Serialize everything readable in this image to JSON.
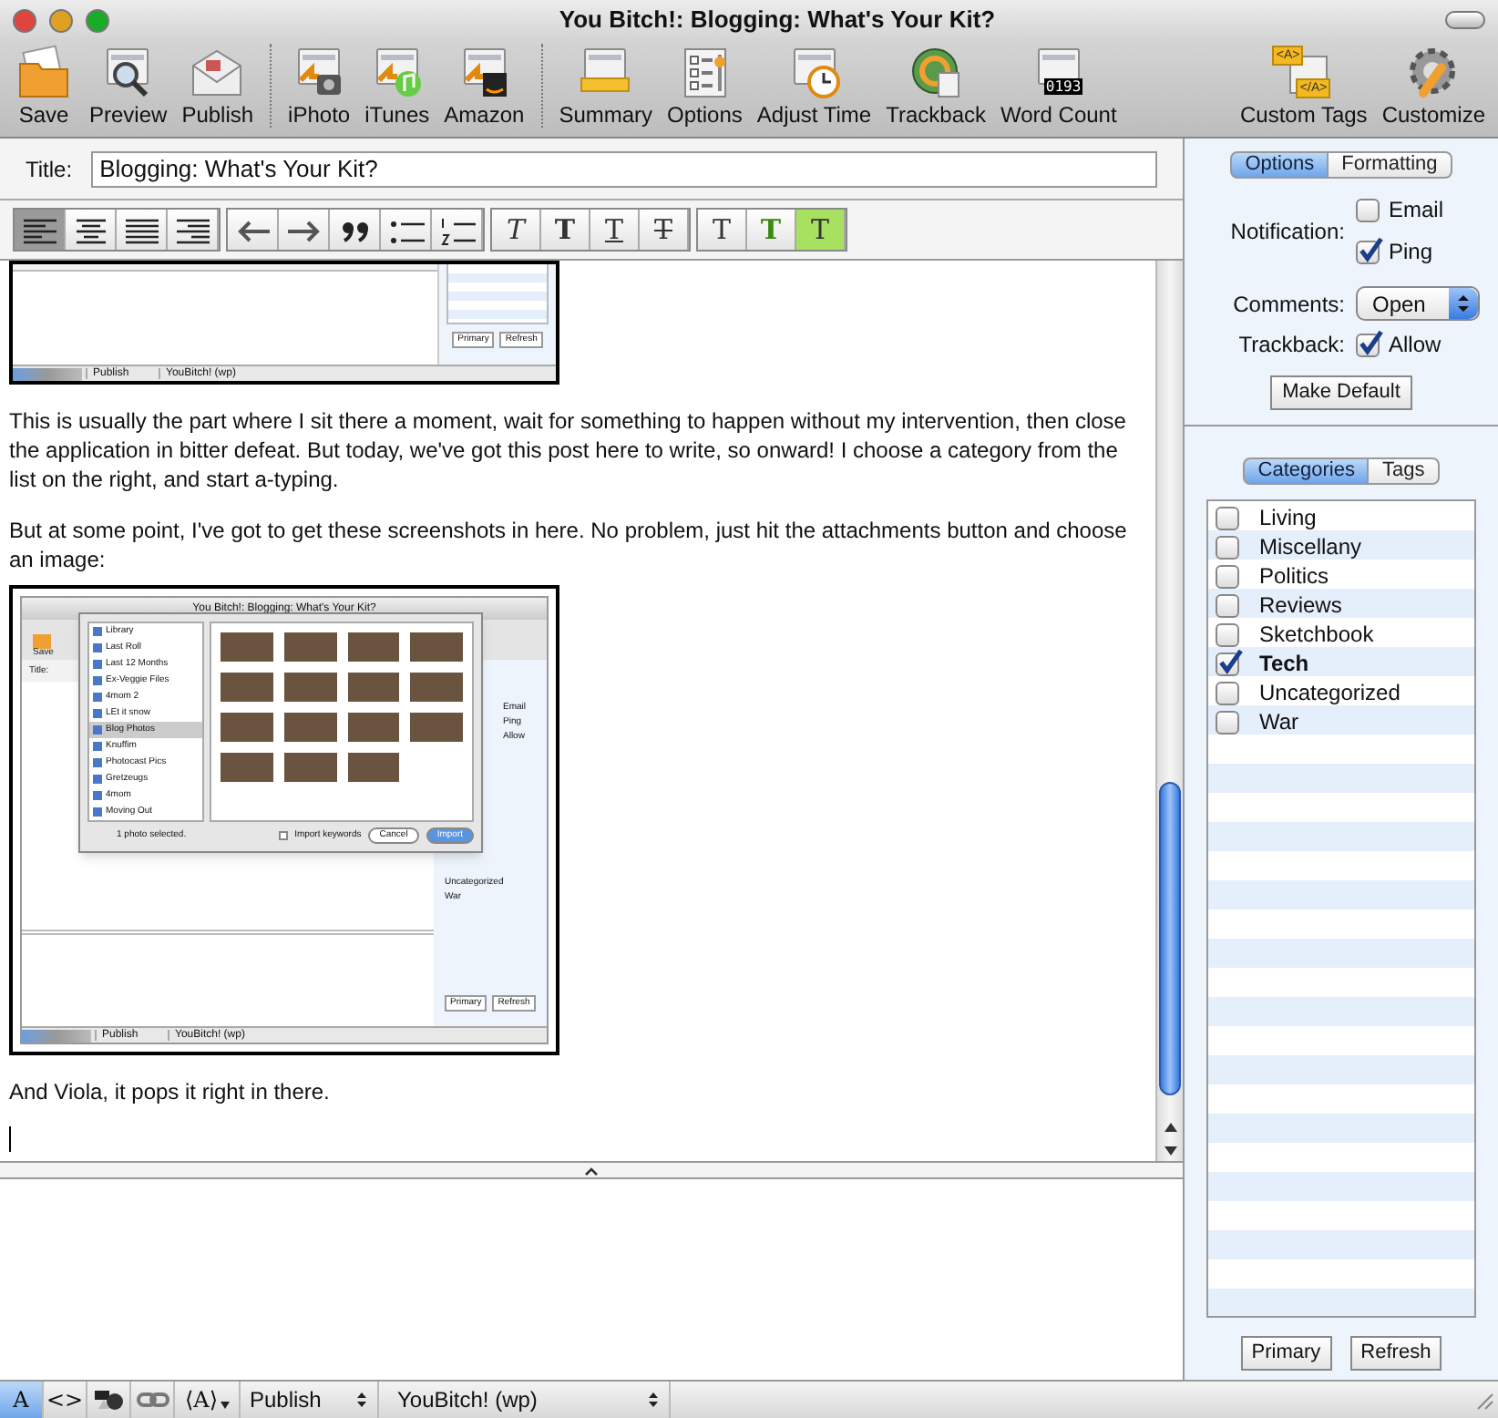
{
  "window": {
    "title": "You Bitch!: Blogging: What's Your Kit?"
  },
  "toolbar": {
    "groups": [
      {
        "items": [
          {
            "label": "Save"
          },
          {
            "label": "Preview"
          },
          {
            "label": "Publish"
          }
        ]
      },
      {
        "items": [
          {
            "label": "iPhoto"
          },
          {
            "label": "iTunes"
          },
          {
            "label": "Amazon"
          }
        ]
      },
      {
        "items": [
          {
            "label": "Summary"
          },
          {
            "label": "Options"
          },
          {
            "label": "Adjust Time"
          },
          {
            "label": "Trackback"
          },
          {
            "label": "Word Count",
            "icon_texts": [
              "0193"
            ]
          }
        ]
      },
      {
        "items": [
          {
            "label": "Custom Tags",
            "icon_texts": [
              "<A>",
              "</A>"
            ]
          },
          {
            "label": "Customize"
          }
        ]
      }
    ]
  },
  "title_field": {
    "label": "Title:",
    "value": "Blogging: What's Your Kit?"
  },
  "format_toolbar": {
    "alignment": [
      {
        "selected": true
      },
      {
        "selected": false
      },
      {
        "selected": false
      },
      {
        "selected": false
      }
    ],
    "style_groups": [
      {
        "items": [
          {
            "text": "T",
            "kind": "italic"
          },
          {
            "text": "T",
            "kind": "bold"
          },
          {
            "text": "T",
            "kind": "underline"
          },
          {
            "text": "T",
            "kind": "strike"
          }
        ]
      },
      {
        "items": [
          {
            "text": "T",
            "kind": "plain"
          },
          {
            "text": "T",
            "kind": "color"
          },
          {
            "text": "T",
            "kind": "highlight"
          }
        ]
      }
    ]
  },
  "editor": {
    "blocks": [
      {
        "kind": "screenshot_bottom",
        "buttons": [
          "Primary",
          "Refresh"
        ],
        "bottom_bar": [
          "Publish",
          "YouBitch! (wp)"
        ]
      },
      {
        "kind": "paragraph",
        "text": "This is usually the part where I sit there a moment, wait for something to happen without my intervention, then close the application in bitter defeat.  But today, we've got this post here to write, so onward!  I choose a category from the list on the right, and start a-typing."
      },
      {
        "kind": "paragraph",
        "text": "But at some point, I've got to get these screenshots in here.  No problem, just hit the attachments button and choose an image:"
      },
      {
        "kind": "screenshot_dialog",
        "window_title": "You Bitch!: Blogging: What's Your Kit?",
        "toolbar_label": "Save",
        "title_label": "Title:",
        "sources": [
          {
            "label": "Library",
            "selected": false
          },
          {
            "label": "Last Roll",
            "selected": false
          },
          {
            "label": "Last 12 Months",
            "selected": false
          },
          {
            "label": "Ex-Veggie Files",
            "selected": false
          },
          {
            "label": "4mom 2",
            "selected": false
          },
          {
            "label": "LEt it snow",
            "selected": false
          },
          {
            "label": "Blog Photos",
            "selected": true
          },
          {
            "label": "Knuffim",
            "selected": false
          },
          {
            "label": "Photocast Pics",
            "selected": false
          },
          {
            "label": "Gretzeugs",
            "selected": false
          },
          {
            "label": "4mom",
            "selected": false
          },
          {
            "label": "Moving Out",
            "selected": false
          }
        ],
        "status": "1 photo selected.",
        "checkbox": {
          "label": "Import keywords",
          "checked": false
        },
        "dialog_buttons": [
          "Cancel",
          "Import"
        ],
        "side_options": [
          "Email",
          "Ping",
          "Allow"
        ],
        "side_categories": [
          "Uncategorized",
          "War"
        ],
        "buttons": [
          "Primary",
          "Refresh"
        ],
        "bottom_bar": [
          "Publish",
          "YouBitch! (wp)"
        ]
      },
      {
        "kind": "paragraph",
        "text": "And Viola, it pops it right in there."
      }
    ]
  },
  "options_panel": {
    "tabs": [
      {
        "label": "Options",
        "selected": true
      },
      {
        "label": "Formatting",
        "selected": false
      }
    ],
    "notification": {
      "label": "Notification:",
      "options": [
        {
          "label": "Email",
          "checked": false
        },
        {
          "label": "Ping",
          "checked": true
        }
      ]
    },
    "comments": {
      "label": "Comments:",
      "value": "Open"
    },
    "trackback": {
      "label": "Trackback:",
      "option": {
        "label": "Allow",
        "checked": true
      }
    },
    "button": "Make Default"
  },
  "categories_panel": {
    "tabs": [
      {
        "label": "Categories",
        "selected": true
      },
      {
        "label": "Tags",
        "selected": false
      }
    ],
    "items": [
      {
        "label": "Living",
        "checked": false
      },
      {
        "label": "Miscellany",
        "checked": false
      },
      {
        "label": "Politics",
        "checked": false
      },
      {
        "label": "Reviews",
        "checked": false
      },
      {
        "label": "Sketchbook",
        "checked": false
      },
      {
        "label": "Tech",
        "checked": true
      },
      {
        "label": "Uncategorized",
        "checked": false
      },
      {
        "label": "War",
        "checked": false
      }
    ],
    "buttons": [
      "Primary",
      "Refresh"
    ]
  },
  "bottom_bar": {
    "items": [
      {
        "kind": "text",
        "label": "A",
        "selected": true
      },
      {
        "kind": "text",
        "label": "<>",
        "selected": false
      },
      {
        "kind": "shapes",
        "selected": false
      },
      {
        "kind": "link",
        "selected": false
      },
      {
        "kind": "menu",
        "label": "⟨A⟩",
        "selected": false
      }
    ],
    "selects": [
      {
        "value": "Publish"
      },
      {
        "value": "YouBitch! (wp)"
      }
    ]
  }
}
